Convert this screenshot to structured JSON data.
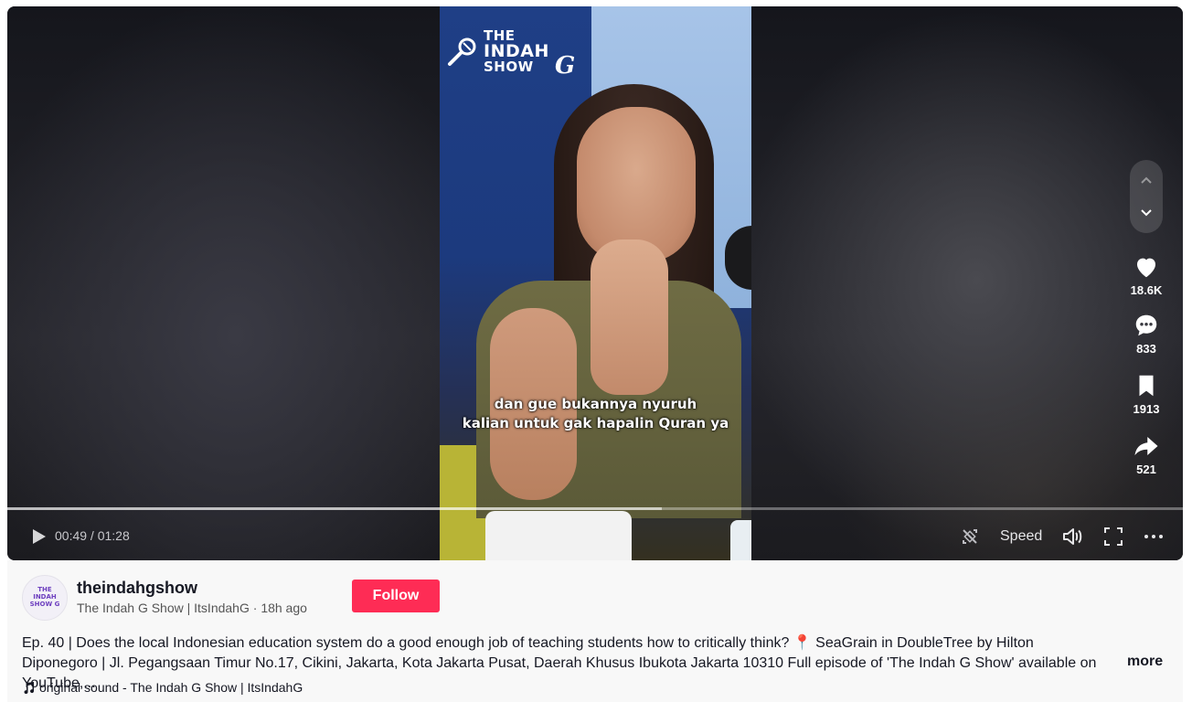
{
  "video": {
    "brand_logo": {
      "line1": "THE",
      "line2": "INDAH",
      "line3": "SHOW",
      "g": "G"
    },
    "caption_line1": "dan gue bukannya nyuruh",
    "caption_line2": "kalian untuk gak hapalin Quran ya",
    "progress": 0.557
  },
  "actions": {
    "likes": "18.6K",
    "comments": "833",
    "saves": "1913",
    "shares": "521"
  },
  "controls": {
    "current_time": "00:49",
    "duration": "01:28",
    "time_separator": " / ",
    "speed_label": "Speed"
  },
  "author": {
    "username": "theindahgshow",
    "display_name": "The Indah G Show | ItsIndahG",
    "separator": " · ",
    "posted": "18h ago",
    "avatar_text": "THE INDAH SHOW G",
    "follow_label": "Follow"
  },
  "description": {
    "text": "Ep. 40 | Does the local Indonesian education system do a good enough job of teaching students how to critically think? 📍 SeaGrain in DoubleTree by Hilton Diponegoro | Jl. Pegangsaan Timur No.17, Cikini, Jakarta, Kota Jakarta Pusat, Daerah Khusus Ibukota Jakarta 10310 Full episode of 'The Indah G Show' available on YouTube,...",
    "more_label": "more"
  },
  "sound": {
    "label": "original sound - The Indah G Show | ItsIndahG"
  },
  "colors": {
    "follow_button": "#fe2c55",
    "text_primary": "#161823"
  }
}
